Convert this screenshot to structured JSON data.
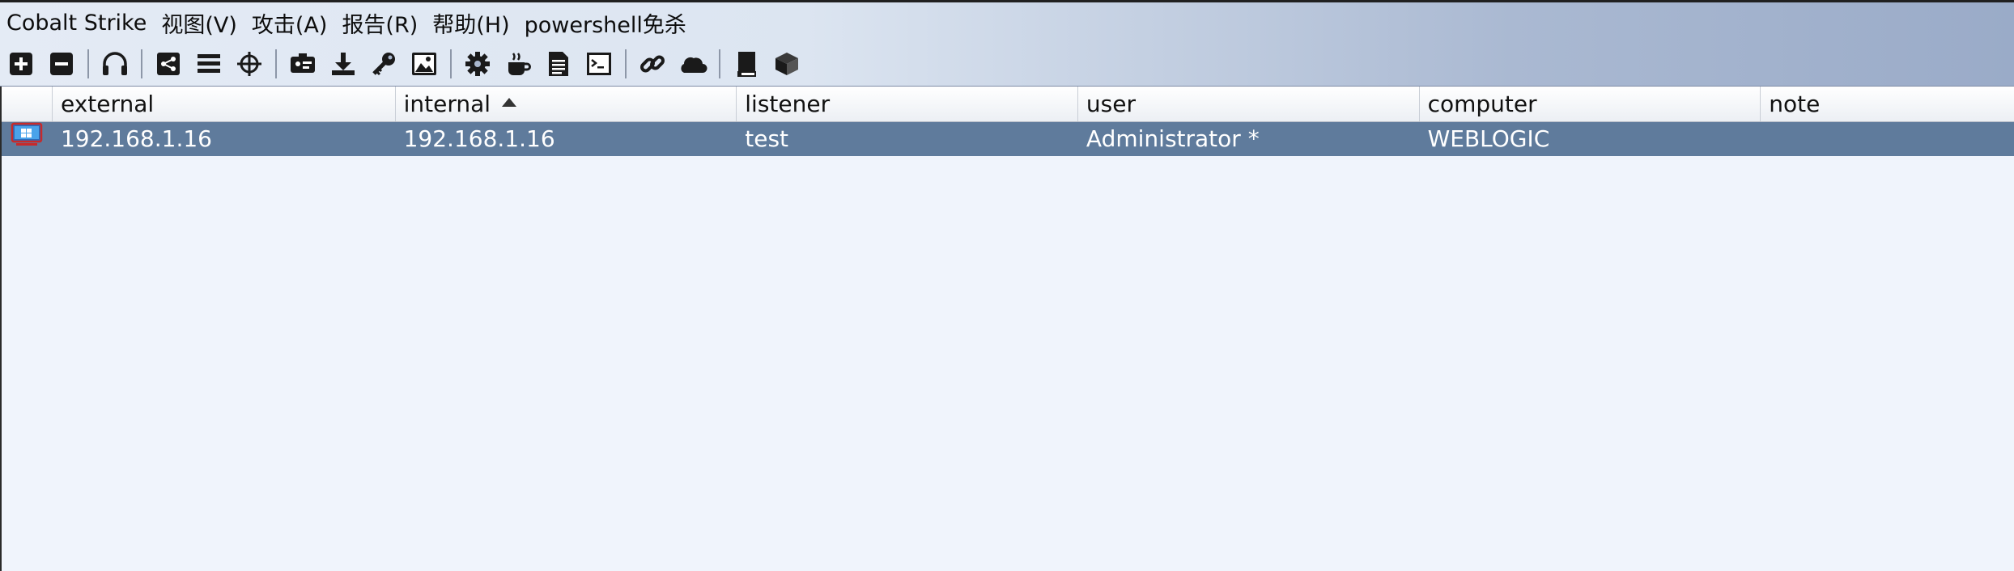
{
  "menubar": {
    "items": [
      {
        "label": "Cobalt Strike"
      },
      {
        "label": "视图(V)"
      },
      {
        "label": "攻击(A)"
      },
      {
        "label": "报告(R)"
      },
      {
        "label": "帮助(H)"
      },
      {
        "label": "powershell免杀"
      }
    ]
  },
  "toolbar": {
    "icons": [
      "add-icon",
      "remove-icon",
      "headphones-icon",
      "pivot-graph-icon",
      "list-icon",
      "crosshair-icon",
      "credentials-icon",
      "download-icon",
      "key-icon",
      "screenshot-icon",
      "gear-icon",
      "coffee-icon",
      "document-icon",
      "terminal-icon",
      "link-icon",
      "cloud-icon",
      "book-icon",
      "cube-icon"
    ]
  },
  "table": {
    "columns": [
      "",
      "external",
      "internal",
      "listener",
      "user",
      "computer",
      "note"
    ],
    "sorted_column": "internal",
    "sort_direction": "ascending",
    "rows": [
      {
        "icon": "windows-beacon-icon",
        "external": "192.168.1.16",
        "internal": "192.168.1.16",
        "listener": "test",
        "user": "Administrator *",
        "computer": "WEBLOGIC",
        "note": "",
        "selected": true
      }
    ]
  },
  "colors": {
    "selected_row": "#5f7b9c",
    "table_background": "#f0f4fc",
    "toolbar_gradient_end": "#9aabc8"
  }
}
